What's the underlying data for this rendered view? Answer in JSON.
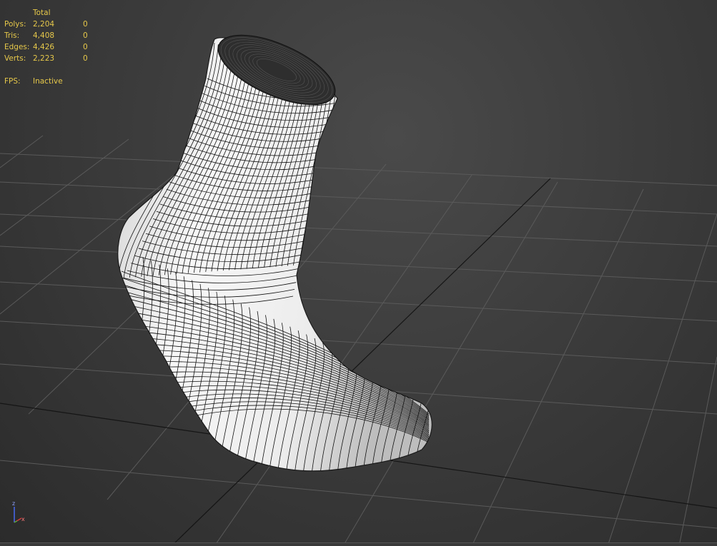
{
  "viewport": {
    "stats": {
      "header": "Total",
      "rows": [
        {
          "label": "Polys:",
          "total": "2,204",
          "selected": "0"
        },
        {
          "label": "Tris:",
          "total": "4,408",
          "selected": "0"
        },
        {
          "label": "Edges:",
          "total": "4,426",
          "selected": "0"
        },
        {
          "label": "Verts:",
          "total": "2,223",
          "selected": "0"
        }
      ],
      "fps_label": "FPS:",
      "fps_value": "Inactive"
    },
    "axis_tripod": {
      "z": "z",
      "x": "x"
    },
    "colors": {
      "stats_text": "#e6c84a",
      "background": "#3c3c3c",
      "grid": "#5a5a5a",
      "mesh_fill": "#f2f2f2",
      "wire": "#111111",
      "axis_x": "#d23c3c",
      "axis_z": "#4a6cff"
    },
    "object": "sock-mesh"
  }
}
